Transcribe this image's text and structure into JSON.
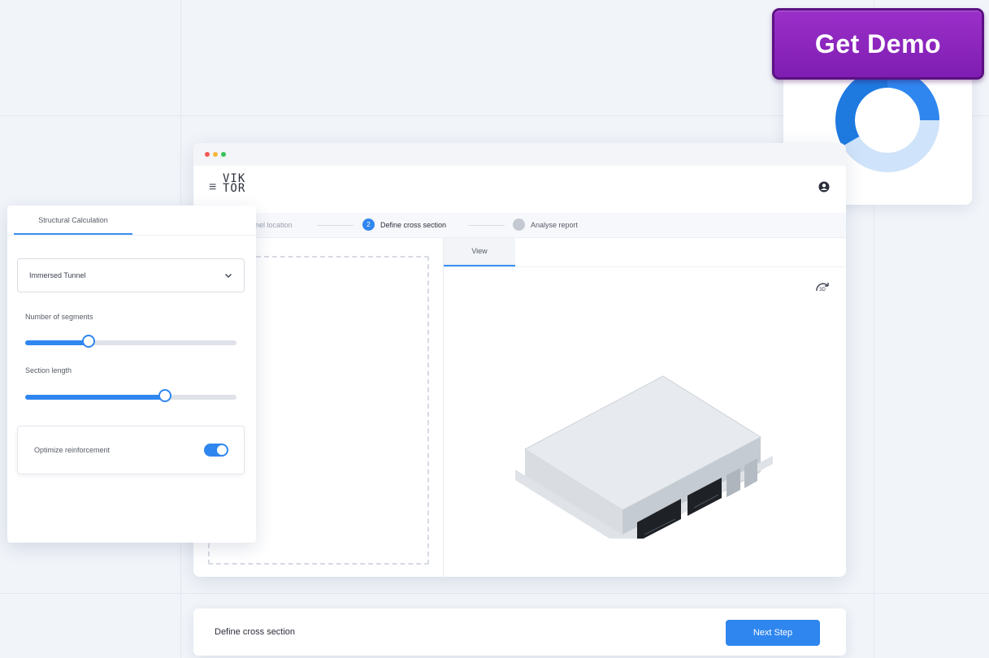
{
  "cta": {
    "label": "Get Demo"
  },
  "window": {
    "logo_line1": "VIK",
    "logo_line2": "TOR"
  },
  "stepper": {
    "steps": [
      {
        "label": "Select tunnel location",
        "state": "done"
      },
      {
        "label": "Define cross section",
        "state": "active",
        "number": "2"
      },
      {
        "label": "Analyse report",
        "state": "pending"
      }
    ]
  },
  "view": {
    "tab_label": "View",
    "rotate_icon": "3D"
  },
  "panel": {
    "tab_label": "Structural Calculation",
    "select_value": "Immersed Tunnel",
    "segments_label": "Number of segments",
    "segments_level": 0.3,
    "length_label": "Section length",
    "length_level": 0.66,
    "toggle_label": "Optimize reinforcement",
    "toggle_on": true
  },
  "bottom": {
    "title": "Define cross section",
    "next_label": "Next Step"
  },
  "colors": {
    "accent": "#2f86ef",
    "cta": "#8a24bf",
    "donut_dark": "#1f7ae0",
    "donut_light": "#cfe3fa"
  }
}
